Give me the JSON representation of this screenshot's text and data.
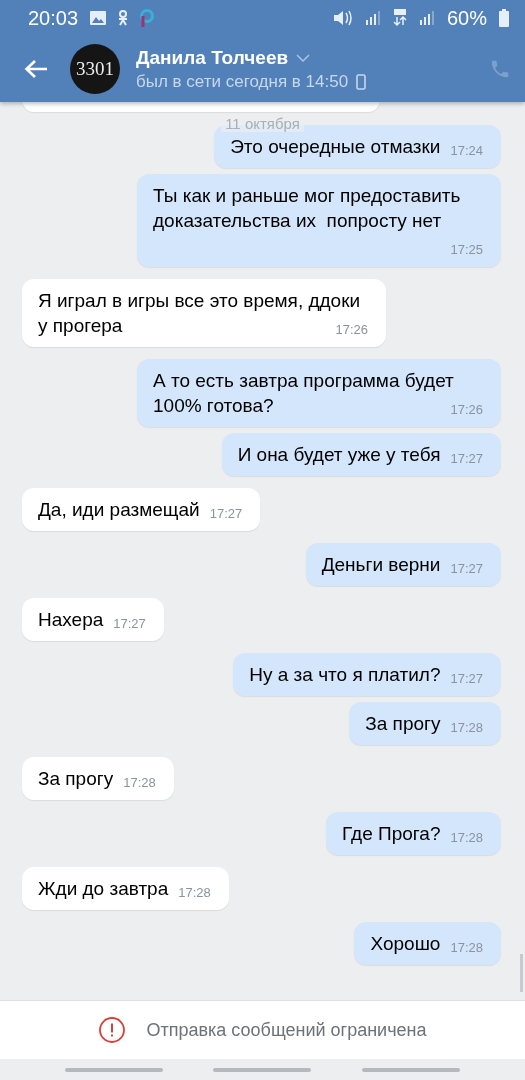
{
  "status_bar": {
    "time": "20:03",
    "battery": "60%"
  },
  "header": {
    "name": "Данила Толчеев",
    "avatar_text": "3301",
    "last_seen": "был в сети сегодня в 14:50"
  },
  "date_label": "11 октября",
  "messages": [
    {
      "kind": "out",
      "text": "Это очередные отмазки",
      "time": "17:24"
    },
    {
      "kind": "out",
      "text": "Ты как и раньше мог предоставить доказательства их  попросту нет",
      "time": "17:25"
    },
    {
      "kind": "in",
      "text": "Я играл в игры все это время, ддоки у прогера",
      "time": "17:26"
    },
    {
      "kind": "out",
      "text": "А то есть завтра программа будет 100% готова?",
      "time": "17:26"
    },
    {
      "kind": "out",
      "text": "И она будет уже у тебя",
      "time": "17:27"
    },
    {
      "kind": "in",
      "text": "Да, иди размещай",
      "time": "17:27"
    },
    {
      "kind": "out",
      "text": "Деньги верни",
      "time": "17:27"
    },
    {
      "kind": "in",
      "text": "Нахера",
      "time": "17:27"
    },
    {
      "kind": "out",
      "text": "Ну а за что я платил?",
      "time": "17:27"
    },
    {
      "kind": "out",
      "text": "За прогу",
      "time": "17:28"
    },
    {
      "kind": "in",
      "text": "За прогу",
      "time": "17:28"
    },
    {
      "kind": "out",
      "text": "Где Прога?",
      "time": "17:28"
    },
    {
      "kind": "in",
      "text": "Жди до завтра",
      "time": "17:28"
    },
    {
      "kind": "out",
      "text": "Хорошо",
      "time": "17:28"
    }
  ],
  "notice": "Отправка сообщений ограничена"
}
